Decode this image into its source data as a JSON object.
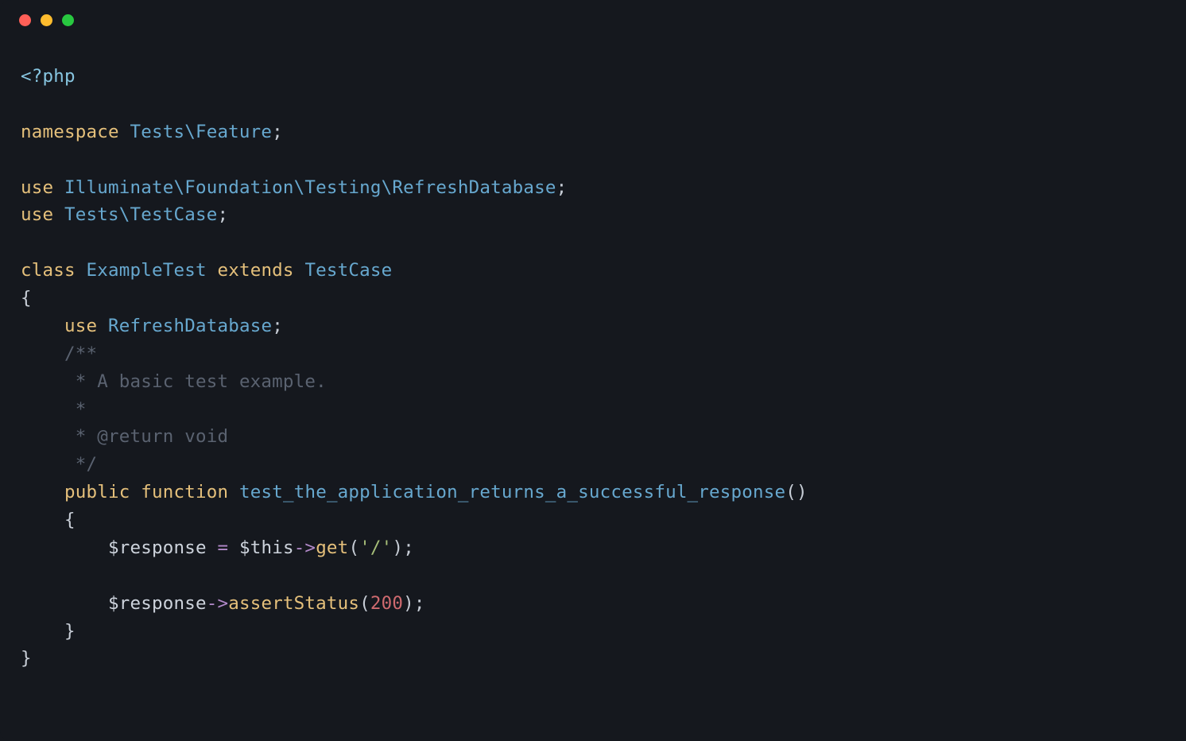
{
  "code": {
    "php_open": "<?php",
    "kw_namespace": "namespace",
    "ns_path": "Tests\\Feature",
    "kw_use": "use",
    "use1": "Illuminate\\Foundation\\Testing\\RefreshDatabase",
    "use2": "Tests\\TestCase",
    "kw_class": "class",
    "class_name": "ExampleTest",
    "kw_extends": "extends",
    "extends_name": "TestCase",
    "brace_open": "{",
    "brace_close": "}",
    "inner_use_kw": "use",
    "inner_use": "RefreshDatabase",
    "comment_l1": "/**",
    "comment_l2": " * A basic test example.",
    "comment_l3": " *",
    "comment_l4": " * @return void",
    "comment_l5": " */",
    "kw_public": "public",
    "kw_function": "function",
    "fn_name": "test_the_application_returns_a_successful_response",
    "fn_parens": "()",
    "var_response": "$response",
    "op_assign": "=",
    "var_this": "$this",
    "op_arrow": "->",
    "call_get": "get",
    "str_root": "'/'",
    "call_assert": "assertStatus",
    "num_200": "200",
    "semi": ";",
    "paren_open": "(",
    "paren_close": ")"
  }
}
